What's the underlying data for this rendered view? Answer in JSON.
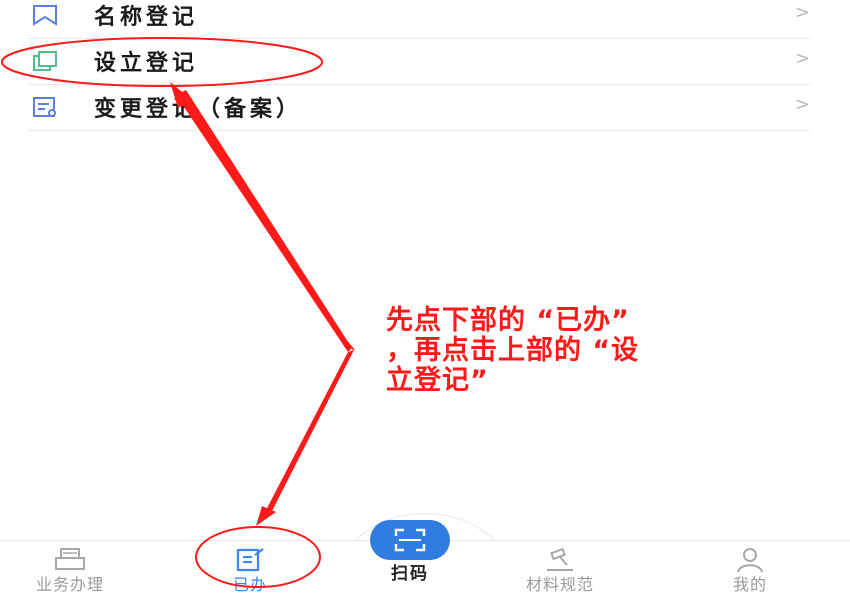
{
  "menu": {
    "items": [
      {
        "label": "名称登记",
        "chevron": ">"
      },
      {
        "label": "设立登记",
        "chevron": ">"
      },
      {
        "label": "变更登记（备案）",
        "chevron": ">"
      }
    ]
  },
  "annotation": {
    "line1": "先点下部的 “已办”",
    "line2": "，再点击上部的 “设",
    "line3": "立登记”"
  },
  "tabbar": {
    "tabs": [
      {
        "label": "业务办理",
        "icon": "printer-icon"
      },
      {
        "label": "已办",
        "icon": "edit-list-icon",
        "active": true
      },
      {
        "label": "扫码",
        "icon": "scan-icon"
      },
      {
        "label": "材料规范",
        "icon": "gavel-icon"
      },
      {
        "label": "我的",
        "icon": "user-icon"
      }
    ]
  },
  "colors": {
    "accent": "#3b86f0",
    "scan": "#2f7de1",
    "annotation": "#ff1a1a",
    "green_icon": "#4cbf8a",
    "blue_icon": "#5c7fe6"
  }
}
